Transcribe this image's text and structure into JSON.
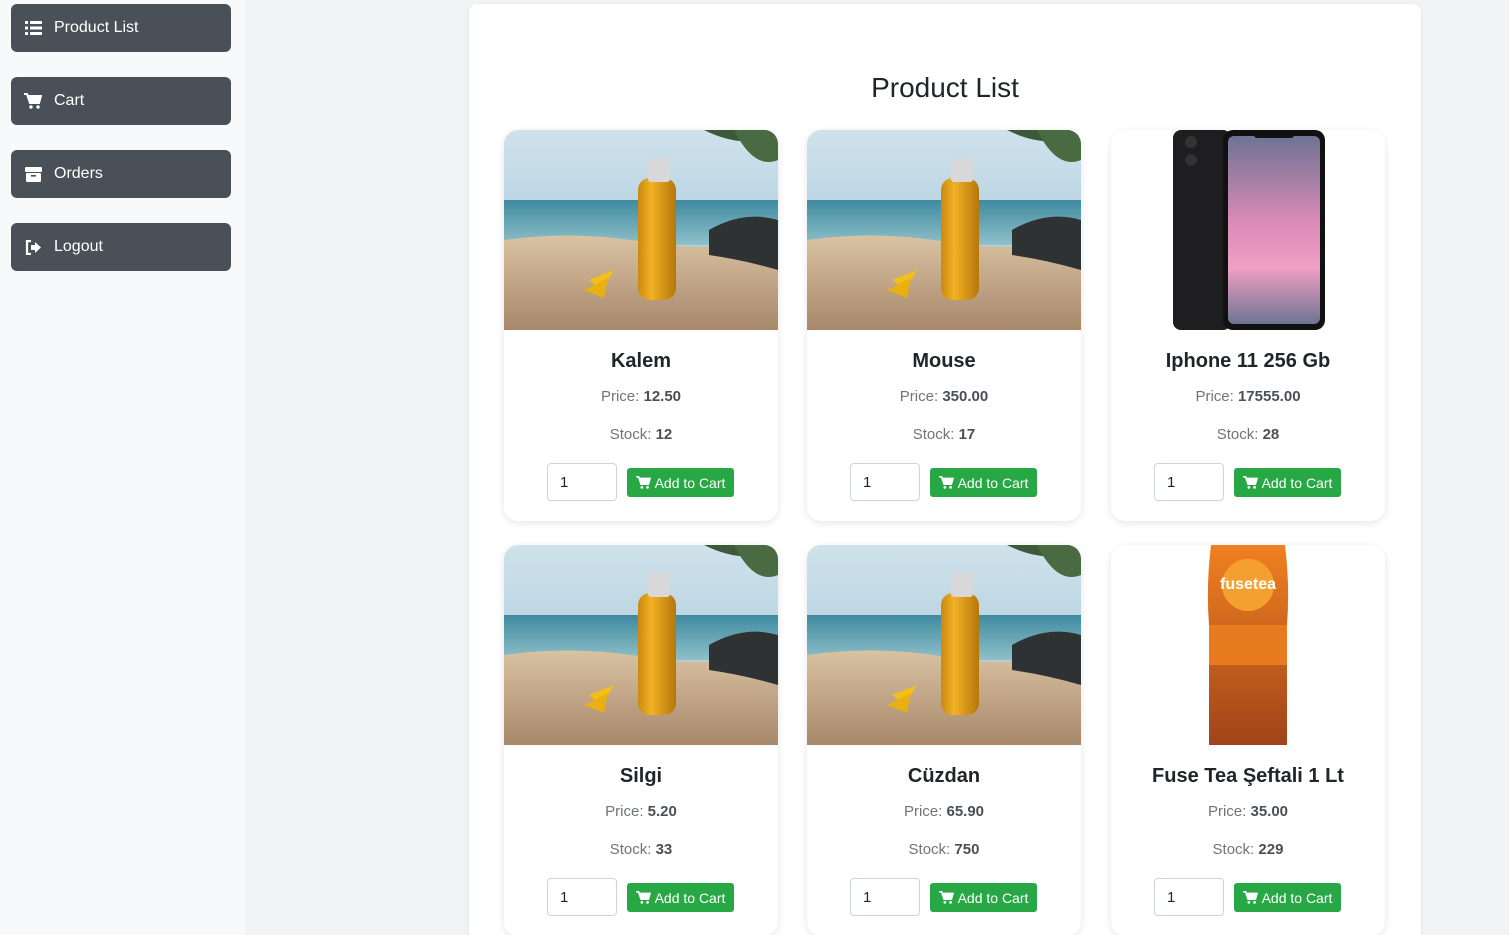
{
  "sidebar": {
    "items": [
      {
        "label": "Product List",
        "icon": "list-icon"
      },
      {
        "label": "Cart",
        "icon": "cart-icon"
      },
      {
        "label": "Orders",
        "icon": "box-icon"
      },
      {
        "label": "Logout",
        "icon": "logout-icon"
      }
    ]
  },
  "main": {
    "title": "Product List",
    "price_label": "Price:",
    "stock_label": "Stock:",
    "add_label": "Add to Cart",
    "products": [
      {
        "name": "Kalem",
        "price": "12.50",
        "stock": "12",
        "qty": "1",
        "image": "sunscreen-bottle-beach"
      },
      {
        "name": "Mouse",
        "price": "350.00",
        "stock": "17",
        "qty": "1",
        "image": "sunscreen-bottle-beach"
      },
      {
        "name": "Iphone 11 256 Gb",
        "price": "17555.00",
        "stock": "28",
        "qty": "1",
        "image": "iphone-11"
      },
      {
        "name": "Silgi",
        "price": "5.20",
        "stock": "33",
        "qty": "1",
        "image": "sunscreen-bottle-beach"
      },
      {
        "name": "Cüzdan",
        "price": "65.90",
        "stock": "750",
        "qty": "1",
        "image": "sunscreen-bottle-beach"
      },
      {
        "name": "Fuse Tea Şeftali 1 Lt",
        "price": "35.00",
        "stock": "229",
        "qty": "1",
        "image": "fuse-tea-bottle"
      }
    ]
  },
  "colors": {
    "sidebar_button": "#495057",
    "add_button": "#28a745",
    "background": "#f1f3f5"
  }
}
